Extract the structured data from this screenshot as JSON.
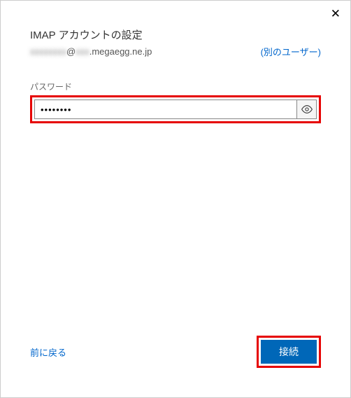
{
  "dialog": {
    "title": "IMAP アカウントの設定",
    "email_masked_prefix": "xxxxxxxx",
    "email_at": "@",
    "email_masked_sub": "xxx",
    "email_domain": ".megaegg.ne.jp",
    "other_user_label": "(別のユーザー)",
    "password_label": "パスワード",
    "password_value": "********",
    "back_label": "前に戻る",
    "connect_label": "接続"
  }
}
